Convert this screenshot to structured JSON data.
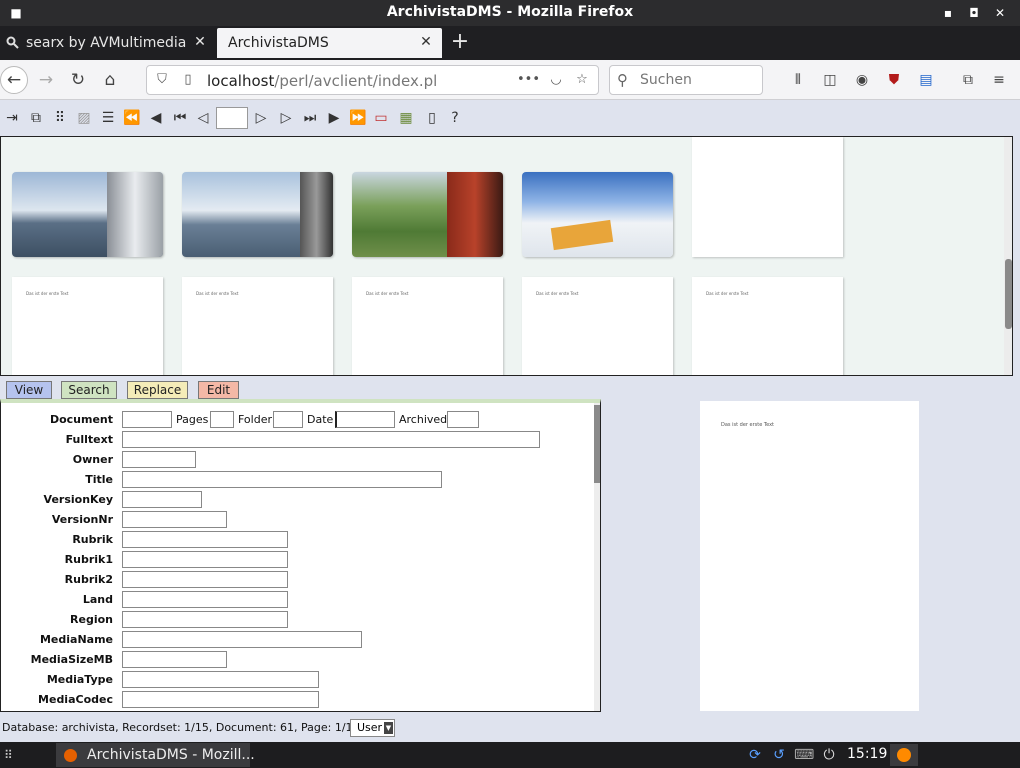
{
  "window": {
    "title": "ArchivistaDMS - Mozilla Firefox"
  },
  "tabs": [
    {
      "label": "searx by AVMultimedia"
    },
    {
      "label": "ArchivistaDMS"
    }
  ],
  "nav": {
    "url_host": "localhost",
    "url_path": "/perl/avclient/index.pl",
    "search_placeholder": "Suchen"
  },
  "toolbar": {
    "page_value": "",
    "help_label": "?"
  },
  "thumbnails": {
    "page_text": "Das ist der erste Text"
  },
  "mode_buttons": {
    "view": "View",
    "search": "Search",
    "replace": "Replace",
    "edit": "Edit"
  },
  "form": {
    "document": "Document",
    "pages": "Pages",
    "folder": "Folder",
    "date": "Date",
    "archived": "Archived",
    "fields": [
      "Fulltext",
      "Owner",
      "Title",
      "VersionKey",
      "VersionNr",
      "Rubrik",
      "Rubrik1",
      "Rubrik2",
      "Land",
      "Region",
      "MediaName",
      "MediaSizeMB",
      "MediaType",
      "MediaCodec"
    ]
  },
  "preview": {
    "text": "Das ist der erste Text"
  },
  "status": {
    "text": "Database: archivista, Recordset: 1/15, Document: 61, Page: 1/1, Form:",
    "form_value": "User"
  },
  "taskbar": {
    "task_label": "ArchivistaDMS - Mozill...",
    "clock": "15:19"
  }
}
